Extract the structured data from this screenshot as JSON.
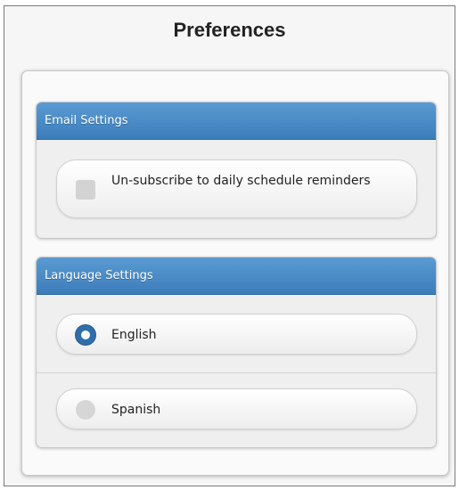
{
  "page": {
    "title": "Preferences"
  },
  "email_settings": {
    "header": "Email Settings",
    "unsubscribe_label": "Un-subscribe to daily schedule reminders",
    "unsubscribe_checked": false
  },
  "language_settings": {
    "header": "Language Settings",
    "options": [
      {
        "label": "English",
        "selected": true
      },
      {
        "label": "Spanish",
        "selected": false
      }
    ]
  },
  "colors": {
    "header_blue": "#4a8bc7",
    "radio_selected": "#2f6eaa",
    "control_gray": "#d3d3d3"
  },
  "icons": {
    "checkbox": "checkbox-unchecked-icon",
    "radio_selected": "radio-selected-icon",
    "radio_unselected": "radio-unselected-icon"
  }
}
